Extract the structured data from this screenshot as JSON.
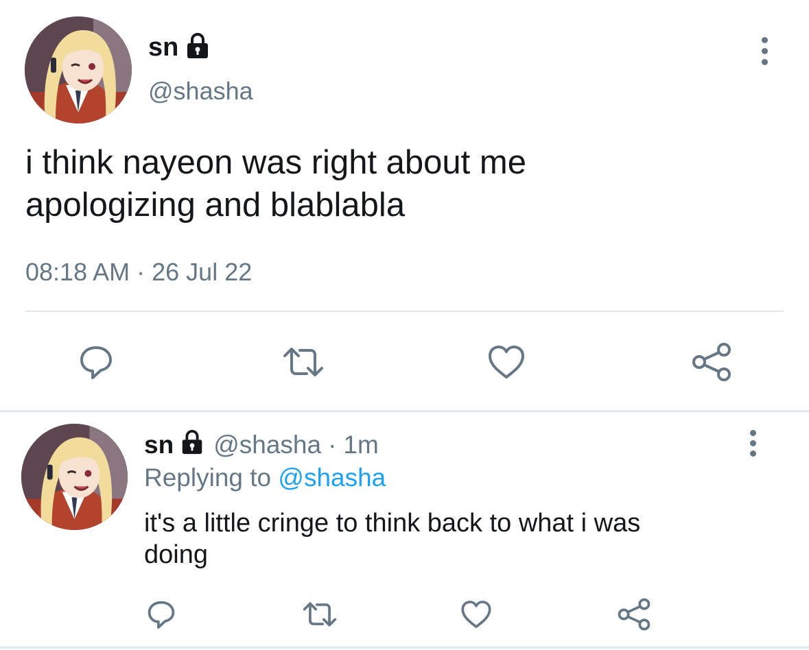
{
  "main_tweet": {
    "display_name": "sn",
    "handle": "@shasha",
    "text_line1": "i think nayeon was right about me",
    "text_line2": "apologizing and blablabla",
    "time": "08:18 AM",
    "separator": "·",
    "date": "26 Jul 22",
    "icons": {
      "lock": "lock-icon",
      "more": "more-vertical-icon",
      "reply": "reply-icon",
      "retweet": "retweet-icon",
      "like": "heart-icon",
      "share": "share-icon"
    }
  },
  "reply_tweet": {
    "display_name": "sn",
    "handle": "@shasha",
    "separator": "·",
    "time_ago": "1m",
    "replying_label": "Replying to",
    "replying_handle": "@shasha",
    "text_line1": "it's a little cringe to think back to what i was",
    "text_line2": "doing"
  },
  "colors": {
    "text": "#14171a",
    "secondary": "#657786",
    "link": "#1da1f2",
    "divider": "#e1e8ed"
  }
}
